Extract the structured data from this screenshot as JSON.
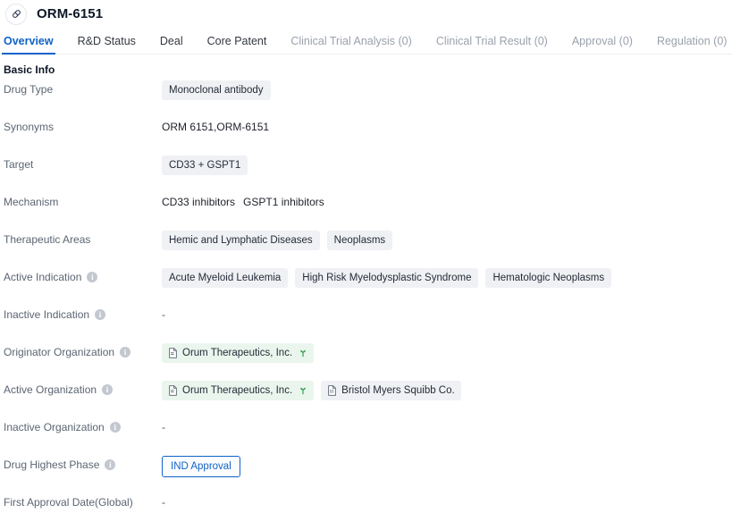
{
  "header": {
    "icon": "pill-capsule-icon",
    "title": "ORM-6151"
  },
  "tabs": [
    {
      "label": "Overview",
      "state": "active"
    },
    {
      "label": "R&D Status",
      "state": "enabled"
    },
    {
      "label": "Deal",
      "state": "enabled"
    },
    {
      "label": "Core Patent",
      "state": "enabled"
    },
    {
      "label": "Clinical Trial Analysis (0)",
      "state": "disabled"
    },
    {
      "label": "Clinical Trial Result (0)",
      "state": "disabled"
    },
    {
      "label": "Approval (0)",
      "state": "disabled"
    },
    {
      "label": "Regulation (0)",
      "state": "disabled"
    }
  ],
  "section": {
    "title": "Basic Info"
  },
  "rows": [
    {
      "label": "Drug Type",
      "info": false,
      "type": "tags",
      "tags": [
        "Monoclonal antibody"
      ]
    },
    {
      "label": "Synonyms",
      "info": false,
      "type": "text",
      "text": "ORM 6151,ORM-6151"
    },
    {
      "label": "Target",
      "info": false,
      "type": "tags",
      "tags": [
        "CD33 + GSPT1"
      ]
    },
    {
      "label": "Mechanism",
      "info": false,
      "type": "mechanism",
      "items": [
        "CD33 inhibitors",
        "GSPT1 inhibitors"
      ]
    },
    {
      "label": "Therapeutic Areas",
      "info": false,
      "type": "tags",
      "tags": [
        "Hemic and Lymphatic Diseases",
        "Neoplasms"
      ]
    },
    {
      "label": "Active Indication",
      "info": true,
      "type": "tags",
      "tags": [
        "Acute Myeloid Leukemia",
        "High Risk Myelodysplastic Syndrome",
        "Hematologic Neoplasms"
      ]
    },
    {
      "label": "Inactive Indication",
      "info": true,
      "type": "empty",
      "text": "-"
    },
    {
      "label": "Originator Organization",
      "info": true,
      "type": "orgs",
      "orgs": [
        {
          "name": "Orum Therapeutics, Inc.",
          "style": "green",
          "sprout": true
        }
      ]
    },
    {
      "label": "Active Organization",
      "info": true,
      "type": "orgs",
      "orgs": [
        {
          "name": "Orum Therapeutics, Inc.",
          "style": "green",
          "sprout": true
        },
        {
          "name": "Bristol Myers Squibb Co.",
          "style": "gray",
          "sprout": false
        }
      ]
    },
    {
      "label": "Inactive Organization",
      "info": true,
      "type": "empty",
      "text": "-"
    },
    {
      "label": "Drug Highest Phase",
      "info": true,
      "type": "phase",
      "phase": "IND Approval"
    },
    {
      "label": "First Approval Date(Global)",
      "info": false,
      "type": "empty",
      "text": "-"
    }
  ],
  "colors": {
    "accent": "#1063c7",
    "tag_bg": "#f0f1f4",
    "org_green_bg": "#eaf6ed",
    "label_text": "#5b6573",
    "title_text": "#0e1726"
  }
}
